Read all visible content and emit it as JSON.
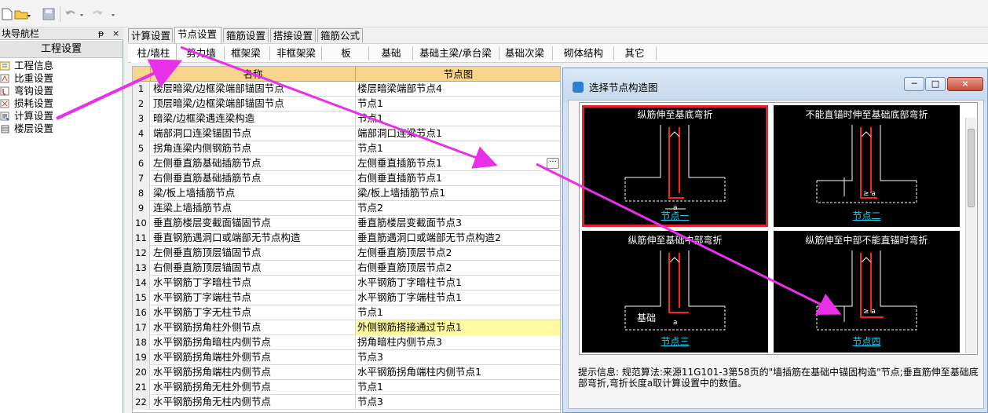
{
  "nav": {
    "title": "模块导航栏",
    "title_visible": "块导航栏",
    "pin": "ᵽ",
    "close": "×",
    "group": "工程设置",
    "items": [
      {
        "label": "工程信息",
        "icon": "info-icon"
      },
      {
        "label": "比重设置",
        "icon": "weight-icon"
      },
      {
        "label": "弯钩设置",
        "icon": "hook-icon"
      },
      {
        "label": "损耗设置",
        "icon": "loss-icon"
      },
      {
        "label": "计算设置",
        "icon": "calc-icon"
      },
      {
        "label": "楼层设置",
        "icon": "floor-icon"
      }
    ]
  },
  "tabs": [
    "计算设置",
    "节点设置",
    "箍筋设置",
    "搭接设置",
    "箍筋公式"
  ],
  "subtabs": [
    "柱/墙柱",
    "剪力墙",
    "框架梁",
    "非框架梁",
    "板",
    "基础",
    "基础主梁/承台梁",
    "基础次梁",
    "砌体结构",
    "其它"
  ],
  "grid": {
    "headers": [
      "名称",
      "节点图"
    ],
    "rows": [
      {
        "n": "1",
        "name": "楼层暗梁/边框梁端部锚固节点",
        "node": "楼层暗梁端部节点4"
      },
      {
        "n": "2",
        "name": "顶层暗梁/边框梁端部锚固节点",
        "node": "节点1"
      },
      {
        "n": "3",
        "name": "暗梁/边框梁遇连梁构造",
        "node": "节点1"
      },
      {
        "n": "4",
        "name": "端部洞口连梁锚固节点",
        "node": "端部洞口连梁节点1"
      },
      {
        "n": "5",
        "name": "拐角连梁内侧钢筋节点",
        "node": "节点1"
      },
      {
        "n": "6",
        "name": "左侧垂直筋基础插筋节点",
        "node": "左侧垂直插筋节点1"
      },
      {
        "n": "7",
        "name": "右侧垂直筋基础插筋节点",
        "node": "右侧垂直插筋节点1"
      },
      {
        "n": "8",
        "name": "梁/板上墙插筋节点",
        "node": "梁/板上墙插筋节点1"
      },
      {
        "n": "9",
        "name": "连梁上墙插筋节点",
        "node": "节点2"
      },
      {
        "n": "10",
        "name": "垂直筋楼层变截面锚固节点",
        "node": "垂直筋楼层变截面节点3"
      },
      {
        "n": "11",
        "name": "垂直钢筋遇洞口或端部无节点构造",
        "node": "垂直筋遇洞口或端部无节点构造2"
      },
      {
        "n": "12",
        "name": "左侧垂直筋顶层锚固节点",
        "node": "左侧垂直筋顶层节点2"
      },
      {
        "n": "13",
        "name": "右侧垂直筋顶层锚固节点",
        "node": "右侧垂直筋顶层节点2"
      },
      {
        "n": "14",
        "name": "水平钢筋丁字暗柱节点",
        "node": "水平钢筋丁字暗柱节点1"
      },
      {
        "n": "15",
        "name": "水平钢筋丁字端柱节点",
        "node": "水平钢筋丁字端柱节点1"
      },
      {
        "n": "16",
        "name": "水平钢筋丁字无柱节点",
        "node": "节点1"
      },
      {
        "n": "17",
        "name": "水平钢筋拐角柱外侧节点",
        "node": "外侧钢筋搭接通过节点1"
      },
      {
        "n": "18",
        "name": "水平钢筋拐角暗柱内侧节点",
        "node": "拐角暗柱内侧节点3"
      },
      {
        "n": "19",
        "name": "水平钢筋拐角端柱外侧节点",
        "node": "节点3"
      },
      {
        "n": "20",
        "name": "水平钢筋拐角端柱内侧节点",
        "node": "水平钢筋拐角端柱内侧节点1"
      },
      {
        "n": "21",
        "name": "水平钢筋拐角无柱外侧节点",
        "node": "节点1"
      },
      {
        "n": "22",
        "name": "水平钢筋拐角无柱内侧节点",
        "node": "节点3"
      }
    ],
    "ellipsis": "···"
  },
  "dialog": {
    "title": "选择节点构造图",
    "minimize": "─",
    "maximize": "□",
    "close": "×",
    "nodes": [
      {
        "caption": "纵筋伸至基底弯折",
        "label": "节点一",
        "selected": true
      },
      {
        "caption": "不能直锚时伸至基础底部弯折",
        "label": "节点二",
        "selected": false
      },
      {
        "caption": "纵筋伸至基础中部弯折",
        "label": "节点三",
        "selected": false
      },
      {
        "caption": "纵筋伸至中部不能直锚时弯折",
        "label": "节点四",
        "selected": false
      }
    ],
    "drawing_text": {
      "a": "a",
      "ge_a": "≥ a",
      "base": "基础",
      "la": "≥ la"
    },
    "hint": "提示信息:  规范算法:来源11G101-3第58页的\"墙插筋在基础中锚固构造\"节点;垂直筋伸至基础底部弯折,弯折长度a取计算设置中的数值。"
  },
  "colors": {
    "accent": "#f7d58c",
    "highlight": "#fffaa0",
    "selected": "#e8202a",
    "arrow": "#e830e8",
    "link": "#21d0f0",
    "rebar": "#ff2020"
  }
}
